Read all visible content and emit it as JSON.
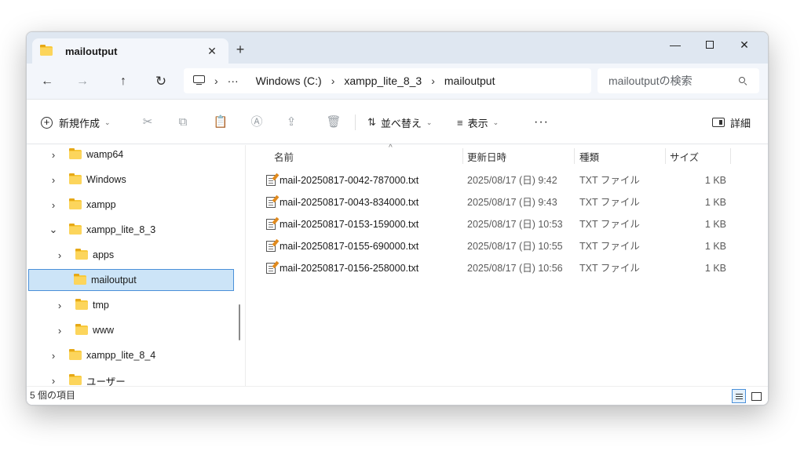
{
  "tab": {
    "title": "mailoutput",
    "close": "✕",
    "new": "+"
  },
  "window_controls": {
    "minimize": "—",
    "close": "✕"
  },
  "nav": {
    "back": "←",
    "forward": "→",
    "up": "↑",
    "refresh": "↻"
  },
  "address": {
    "sep": "›",
    "overflow": "···",
    "crumbs": [
      "Windows (C:)",
      "xampp_lite_8_3",
      "mailoutput"
    ]
  },
  "search": {
    "placeholder": "mailoutputの検索"
  },
  "commandbar": {
    "new_label": "新規作成",
    "sort_label": "並べ替え",
    "view_label": "表示",
    "more_label": "···",
    "details_label": "詳細",
    "icons": {
      "cut": "✂",
      "copy": "⧉",
      "paste": "📋",
      "rename": "Ⓐ",
      "share": "⇪",
      "delete": "🗑"
    }
  },
  "tree": [
    {
      "label": "wamp64",
      "chevron": "›"
    },
    {
      "label": "Windows",
      "chevron": "›"
    },
    {
      "label": "xampp",
      "chevron": "›"
    },
    {
      "label": "xampp_lite_8_3",
      "chevron": "⌄"
    },
    {
      "label": "apps",
      "chevron": "›"
    },
    {
      "label": "mailoutput",
      "chevron": ""
    },
    {
      "label": "tmp",
      "chevron": "›"
    },
    {
      "label": "www",
      "chevron": "›"
    },
    {
      "label": "xampp_lite_8_4",
      "chevron": "›"
    },
    {
      "label": "ユーザー",
      "chevron": "›"
    }
  ],
  "columns": {
    "name": "名前",
    "date": "更新日時",
    "type": "種類",
    "size": "サイズ"
  },
  "files": [
    {
      "name": "mail-20250817-0042-787000.txt",
      "date": "2025/08/17 (日) 9:42",
      "type": "TXT ファイル",
      "size": "1 KB"
    },
    {
      "name": "mail-20250817-0043-834000.txt",
      "date": "2025/08/17 (日) 9:43",
      "type": "TXT ファイル",
      "size": "1 KB"
    },
    {
      "name": "mail-20250817-0153-159000.txt",
      "date": "2025/08/17 (日) 10:53",
      "type": "TXT ファイル",
      "size": "1 KB"
    },
    {
      "name": "mail-20250817-0155-690000.txt",
      "date": "2025/08/17 (日) 10:55",
      "type": "TXT ファイル",
      "size": "1 KB"
    },
    {
      "name": "mail-20250817-0156-258000.txt",
      "date": "2025/08/17 (日) 10:56",
      "type": "TXT ファイル",
      "size": "1 KB"
    }
  ],
  "status": {
    "count": "5 個の項目"
  },
  "colors": {
    "accent": "#4a90d9",
    "selection": "#cce4f7",
    "folder": "#f8c93a",
    "titlebar": "#dfe7f1"
  }
}
